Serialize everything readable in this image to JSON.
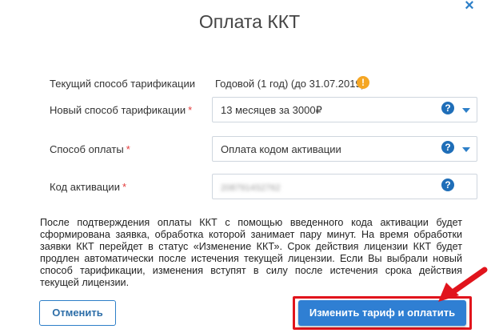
{
  "dialog": {
    "title": "Оплата ККТ",
    "close_icon": "close-icon"
  },
  "form": {
    "current_tariff": {
      "label": "Текущий способ тарификации",
      "value": "Годовой (1 год) (до 31.07.2019)",
      "icon": "warning-icon"
    },
    "new_tariff": {
      "label": "Новый способ тарификации",
      "required_mark": "*",
      "selected": "13 месяцев за 3000₽",
      "icon": "help-icon"
    },
    "payment_method": {
      "label": "Способ оплаты",
      "required_mark": "*",
      "selected": "Оплата кодом активации",
      "icon": "help-icon"
    },
    "activation_code": {
      "label": "Код активации",
      "required_mark": "*",
      "value": "2087914S2762",
      "icon": "help-icon"
    }
  },
  "info_text": "После подтверждения оплаты ККТ с помощью введенного кода активации будет сформирована заявка, обработка которой занимает пару минут. На время обработки заявки ККТ перейдет в статус «Изменение ККТ». Срок действия лицензии ККТ будет продлен автоматически после истечения текущей лицензии. Если Вы выбрали новый способ тарификации, изменения вступят в силу после истечения срока действия текущей лицензии.",
  "buttons": {
    "cancel": "Отменить",
    "confirm": "Изменить тариф и оплатить"
  },
  "colors": {
    "accent": "#2f7fd3",
    "required": "#e33b3b",
    "warning": "#f5a623",
    "highlight": "#e1141c"
  }
}
